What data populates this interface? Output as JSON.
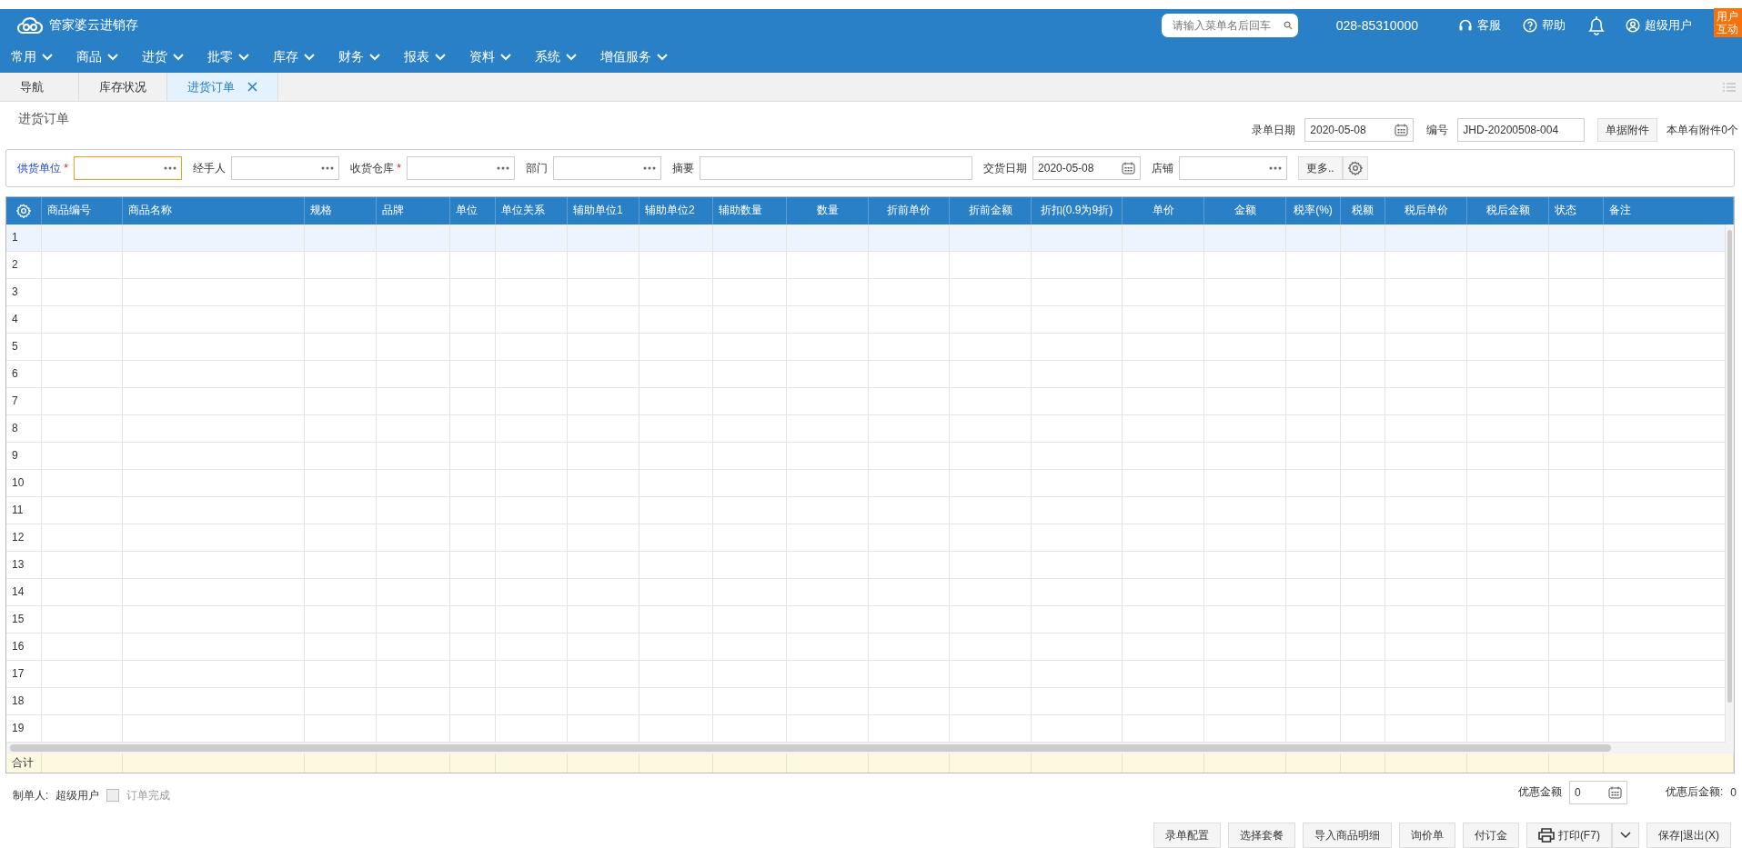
{
  "app": {
    "title": "管家婆云进销存",
    "search": {
      "placeholder": "请输入菜单名后回车"
    },
    "phone": "028-85310000",
    "links": [
      {
        "label": "客服",
        "kind": "headset"
      },
      {
        "label": "帮助",
        "kind": "help"
      }
    ],
    "user": "超级用户",
    "badge": "用户互动"
  },
  "menu": [
    "常用",
    "商品",
    "进货",
    "批零",
    "库存",
    "财务",
    "报表",
    "资料",
    "系统",
    "增值服务"
  ],
  "tabs": [
    {
      "label": "导航",
      "selected": false,
      "closable": false
    },
    {
      "label": "库存状况",
      "selected": false,
      "closable": false
    },
    {
      "label": "进货订单",
      "selected": true,
      "closable": true
    }
  ],
  "page_title": "进货订单",
  "header_fields": [
    {
      "label": "录单日期",
      "value": "2020-05-08",
      "kind": "date"
    },
    {
      "label": "编号",
      "value": "JHD-20200508-004",
      "kind": "text"
    }
  ],
  "attach_button": "单据附件",
  "attach_note": "本单有附件0个",
  "form_fields": [
    {
      "label": "供货单位",
      "required_mark": "*",
      "focused": true,
      "kind": "picker"
    },
    {
      "label": "经手人",
      "focused": false,
      "kind": "picker"
    },
    {
      "label": "收货仓库",
      "required_mark": "*",
      "focused": false,
      "kind": "picker"
    },
    {
      "label": "部门",
      "focused": false,
      "kind": "picker"
    },
    {
      "label": "摘要",
      "focused": false,
      "kind": "text"
    },
    {
      "label": "交货日期",
      "focused": false,
      "kind": "date",
      "value": "2020-05-08"
    },
    {
      "label": "店铺",
      "focused": false,
      "kind": "picker"
    }
  ],
  "more_button": "更多..",
  "table": {
    "columns": [
      "商品编号",
      "商品名称",
      "规格",
      "品牌",
      "单位",
      "单位关系",
      "辅助单位1",
      "辅助单位2",
      "辅助数量",
      "数量",
      "折前单价",
      "折前金额",
      "折扣(0.9为9折)",
      "单价",
      "金额",
      "税率(%)",
      "税额",
      "税后单价",
      "税后金额",
      "状态",
      "备注"
    ],
    "rows": [
      {
        "number": "1",
        "selected": true
      },
      {
        "number": "2",
        "selected": false
      },
      {
        "number": "3",
        "selected": false
      },
      {
        "number": "4",
        "selected": false
      },
      {
        "number": "5",
        "selected": false
      },
      {
        "number": "6",
        "selected": false
      },
      {
        "number": "7",
        "selected": false
      },
      {
        "number": "8",
        "selected": false
      },
      {
        "number": "9",
        "selected": false
      },
      {
        "number": "10",
        "selected": false
      },
      {
        "number": "11",
        "selected": false
      },
      {
        "number": "12",
        "selected": false
      },
      {
        "number": "13",
        "selected": false
      },
      {
        "number": "14",
        "selected": false
      },
      {
        "number": "15",
        "selected": false
      },
      {
        "number": "16",
        "selected": false
      },
      {
        "number": "17",
        "selected": false
      },
      {
        "number": "18",
        "selected": false
      },
      {
        "number": "19",
        "selected": false
      }
    ],
    "total_label": "合计"
  },
  "footer": {
    "creator_label": "制单人:",
    "creator": "超级用户",
    "order_done": {
      "label": "订单完成",
      "checked": false,
      "disabled": true
    },
    "discount_label": "优惠金额",
    "discount_value": "0",
    "after_discount_label": "优惠后金额:",
    "after_discount_value": "0"
  },
  "buttons": [
    {
      "label": "录单配置",
      "kind": "plain"
    },
    {
      "label": "选择套餐",
      "kind": "plain"
    },
    {
      "label": "导入商品明细",
      "kind": "plain"
    },
    {
      "label": "询价单",
      "kind": "plain"
    },
    {
      "label": "付订金",
      "kind": "plain"
    },
    {
      "label": "打印(F7)",
      "kind": "print"
    },
    {
      "label": "保存|退出(X)",
      "kind": "plain"
    }
  ]
}
